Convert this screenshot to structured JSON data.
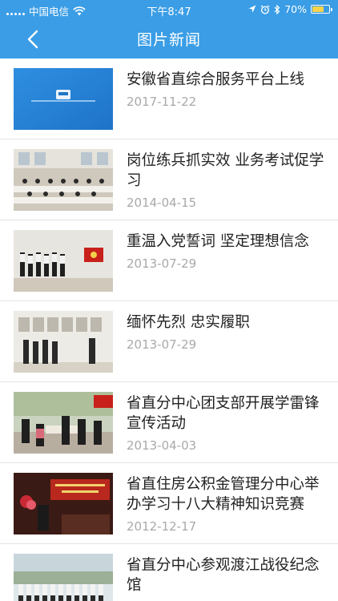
{
  "status_bar": {
    "carrier": "中国电信",
    "time": "下午8:47",
    "battery": "70%",
    "battery_level": 0.7
  },
  "header": {
    "title": "图片新闻"
  },
  "news": [
    {
      "title": "安徽省直综合服务平台上线",
      "date": "2017-11-22"
    },
    {
      "title": "岗位练兵抓实效  业务考试促学习",
      "date": "2014-04-15"
    },
    {
      "title": "重温入党誓词  坚定理想信念",
      "date": "2013-07-29"
    },
    {
      "title": "缅怀先烈 忠实履职",
      "date": "2013-07-29"
    },
    {
      "title": "省直分中心团支部开展学雷锋宣传活动",
      "date": "2013-04-03"
    },
    {
      "title": "省直住房公积金管理分中心举办学习十八大精神知识竞赛",
      "date": "2012-12-17"
    },
    {
      "title": "省直分中心参观渡江战役纪念馆",
      "date": ""
    }
  ]
}
